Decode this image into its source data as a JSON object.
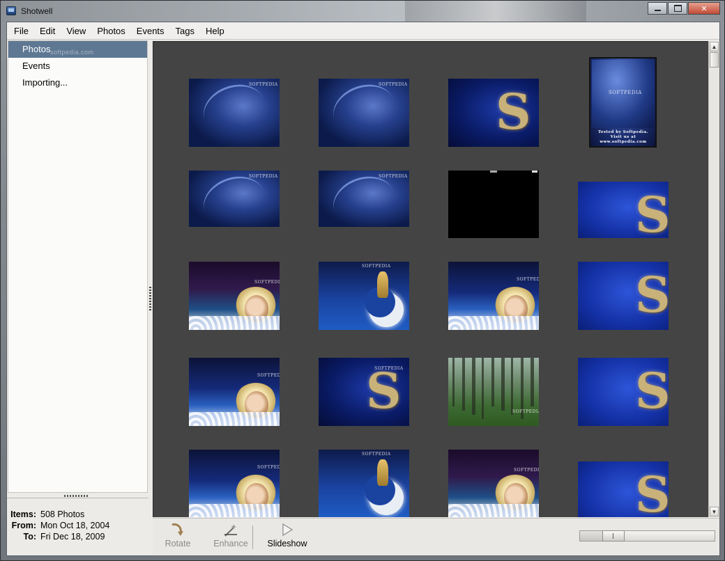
{
  "window": {
    "title": "Shotwell",
    "title_watermark": "SOFTPEDIA"
  },
  "menubar": {
    "items": [
      {
        "label": "File"
      },
      {
        "label": "Edit"
      },
      {
        "label": "View"
      },
      {
        "label": "Photos"
      },
      {
        "label": "Events"
      },
      {
        "label": "Tags"
      },
      {
        "label": "Help"
      }
    ]
  },
  "sidebar": {
    "items": [
      {
        "label": "Photos",
        "selected": true
      },
      {
        "label": "Events",
        "selected": false
      },
      {
        "label": "Importing...",
        "selected": false
      }
    ],
    "selected_watermark": "softpedia.com"
  },
  "stats": {
    "items_label": "Items:",
    "items_value": "508 Photos",
    "from_label": "From:",
    "from_value": "Mon Oct 18, 2004",
    "to_label": "To:",
    "to_value": "Fri Dec 18, 2009"
  },
  "photo_grid": {
    "thumbnails": [
      {
        "kind": "blue-swirl",
        "caption": "SOFTPEDIA"
      },
      {
        "kind": "blue-swirl",
        "caption": "SOFTPEDIA"
      },
      {
        "kind": "s-logo",
        "caption": ""
      },
      {
        "kind": "portrait",
        "caption": "SOFTPEDIA",
        "footer": "Tested by Softpedia. Visit us at www.softpedia.com"
      },
      {
        "kind": "blue-swirl",
        "caption": "SOFTPEDIA"
      },
      {
        "kind": "blue-swirl",
        "caption": "SOFTPEDIA"
      },
      {
        "kind": "black",
        "caption": ""
      },
      {
        "kind": "s-logo-bright",
        "caption": ""
      },
      {
        "kind": "face-purple",
        "caption": "SOFTPEDIA"
      },
      {
        "kind": "moon",
        "caption": "SOFTPEDIA"
      },
      {
        "kind": "face-blue",
        "caption": "SOFTPEDIA"
      },
      {
        "kind": "s-logo-bright",
        "caption": ""
      },
      {
        "kind": "face-blue",
        "caption": "SOFTPEDIA"
      },
      {
        "kind": "s-logo",
        "caption": "SOFTPEDIA"
      },
      {
        "kind": "forest",
        "caption": "SOFTPEDIA"
      },
      {
        "kind": "s-logo-bright",
        "caption": ""
      },
      {
        "kind": "face-blue",
        "caption": "SOFTPEDIA"
      },
      {
        "kind": "moon",
        "caption": "SOFTPEDIA"
      },
      {
        "kind": "face-purple",
        "caption": "SOFTPEDIA"
      },
      {
        "kind": "s-logo-bright",
        "caption": ""
      }
    ]
  },
  "toolbar": {
    "rotate_label": "Rotate",
    "enhance_label": "Enhance",
    "slideshow_label": "Slideshow",
    "rotate_icon": "rotate-icon",
    "enhance_icon": "enhance-wand-icon",
    "slideshow_icon": "play-triangle-icon",
    "zoom_level": 0.25
  },
  "colors": {
    "selection": "#5e7893",
    "viewport_bg": "#444444",
    "panel_bg": "#ecebe8"
  }
}
